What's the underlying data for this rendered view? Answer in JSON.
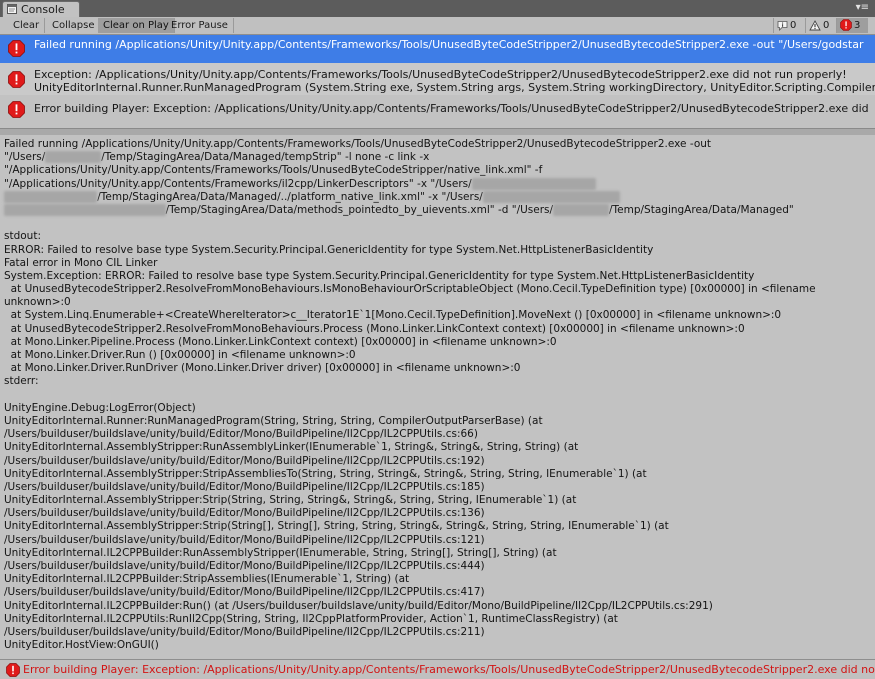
{
  "window": {
    "tab_label": "Console"
  },
  "toolbar": {
    "clear_label": "Clear",
    "collapse_label": "Collapse",
    "clear_on_play_label": "Clear on Play",
    "error_pause_label": "Error Pause",
    "info_count": "0",
    "warning_count": "0",
    "error_count": "3"
  },
  "log_entries": [
    {
      "line1": "Failed running /Applications/Unity/Unity.app/Contents/Frameworks/Tools/UnusedByteCodeStripper2/UnusedBytecodeStripper2.exe -out \"/Users/godstar",
      "line2": ""
    },
    {
      "line1": "Exception: /Applications/Unity/Unity.app/Contents/Frameworks/Tools/UnusedByteCodeStripper2/UnusedBytecodeStripper2.exe did not run properly!",
      "line2": "UnityEditorInternal.Runner.RunManagedProgram (System.String exe, System.String args, System.String workingDirectory, UnityEditor.Scripting.Compilers.Co"
    },
    {
      "line1": "Error building Player: Exception: /Applications/Unity/Unity.app/Contents/Frameworks/Tools/UnusedByteCodeStripper2/UnusedBytecodeStripper2.exe did",
      "line2": ""
    }
  ],
  "detail": {
    "lines": [
      "Failed running /Applications/Unity/Unity.app/Contents/Frameworks/Tools/UnusedByteCodeStripper2/UnusedBytecodeStripper2.exe -out",
      "\"/Users/{B}/Temp/StagingArea/Data/Managed/tempStrip\" -l none -c link -x",
      "\"/Applications/Unity/Unity.app/Contents/Frameworks/Tools/UnusedByteCodeStripper/native_link.xml\" -f",
      "\"/Applications/Unity/Unity.app/Contents/Frameworks/il2cpp/LinkerDescriptors\" -x \"/Users/{B}",
      "{B}/Temp/StagingArea/Data/Managed/../platform_native_link.xml\" -x \"/Users/{B}",
      "{B}/Temp/StagingArea/Data/methods_pointedto_by_uievents.xml\" -d \"/Users/{B}/Temp/StagingArea/Data/Managed\"",
      "",
      "stdout:",
      "ERROR: Failed to resolve base type System.Security.Principal.GenericIdentity for type System.Net.HttpListenerBasicIdentity",
      "Fatal error in Mono CIL Linker",
      "System.Exception: ERROR: Failed to resolve base type System.Security.Principal.GenericIdentity for type System.Net.HttpListenerBasicIdentity",
      "  at UnusedBytecodeStripper2.ResolveFromMonoBehaviours.IsMonoBehaviourOrScriptableObject (Mono.Cecil.TypeDefinition type) [0x00000] in <filename",
      "unknown>:0",
      "  at System.Linq.Enumerable+<CreateWhereIterator>c__Iterator1E`1[Mono.Cecil.TypeDefinition].MoveNext () [0x00000] in <filename unknown>:0",
      "  at UnusedBytecodeStripper2.ResolveFromMonoBehaviours.Process (Mono.Linker.LinkContext context) [0x00000] in <filename unknown>:0",
      "  at Mono.Linker.Pipeline.Process (Mono.Linker.LinkContext context) [0x00000] in <filename unknown>:0",
      "  at Mono.Linker.Driver.Run () [0x00000] in <filename unknown>:0",
      "  at Mono.Linker.Driver.RunDriver (Mono.Linker.Driver driver) [0x00000] in <filename unknown>:0",
      "stderr:",
      "",
      "UnityEngine.Debug:LogError(Object)",
      "UnityEditorInternal.Runner:RunManagedProgram(String, String, String, CompilerOutputParserBase) (at",
      "/Users/builduser/buildslave/unity/build/Editor/Mono/BuildPipeline/Il2Cpp/IL2CPPUtils.cs:66)",
      "UnityEditorInternal.AssemblyStripper:RunAssemblyLinker(IEnumerable`1, String&, String&, String, String) (at",
      "/Users/builduser/buildslave/unity/build/Editor/Mono/BuildPipeline/Il2Cpp/IL2CPPUtils.cs:192)",
      "UnityEditorInternal.AssemblyStripper:StripAssembliesTo(String, String, String&, String&, String, String, IEnumerable`1) (at",
      "/Users/builduser/buildslave/unity/build/Editor/Mono/BuildPipeline/Il2Cpp/IL2CPPUtils.cs:185)",
      "UnityEditorInternal.AssemblyStripper:Strip(String, String, String&, String&, String, String, IEnumerable`1) (at",
      "/Users/builduser/buildslave/unity/build/Editor/Mono/BuildPipeline/Il2Cpp/IL2CPPUtils.cs:136)",
      "UnityEditorInternal.AssemblyStripper:Strip(String[], String[], String, String, String&, String&, String, String, IEnumerable`1) (at",
      "/Users/builduser/buildslave/unity/build/Editor/Mono/BuildPipeline/Il2Cpp/IL2CPPUtils.cs:121)",
      "UnityEditorInternal.IL2CPPBuilder:RunAssemblyStripper(IEnumerable, String, String[], String[], String) (at",
      "/Users/builduser/buildslave/unity/build/Editor/Mono/BuildPipeline/Il2Cpp/IL2CPPUtils.cs:444)",
      "UnityEditorInternal.IL2CPPBuilder:StripAssemblies(IEnumerable`1, String) (at",
      "/Users/builduser/buildslave/unity/build/Editor/Mono/BuildPipeline/Il2Cpp/IL2CPPUtils.cs:417)",
      "UnityEditorInternal.IL2CPPBuilder:Run() (at /Users/builduser/buildslave/unity/build/Editor/Mono/BuildPipeline/Il2Cpp/IL2CPPUtils.cs:291)",
      "UnityEditorInternal.IL2CPPUtils:RunIl2Cpp(String, String, Il2CppPlatformProvider, Action`1, RuntimeClassRegistry) (at",
      "/Users/builduser/buildslave/unity/build/Editor/Mono/BuildPipeline/Il2Cpp/IL2CPPUtils.cs:211)",
      "UnityEditor.HostView:OnGUI()"
    ]
  },
  "status_bar": {
    "message": "Error building Player: Exception: /Applications/Unity/Unity.app/Contents/Frameworks/Tools/UnusedByteCodeStripper2/UnusedBytecodeStripper2.exe did not r"
  },
  "colors": {
    "selection": "#3e7de7",
    "error_red": "#d21414",
    "panel_bg": "#c2c2c2"
  },
  "icons": {
    "tab": "console-icon",
    "info": "info-icon",
    "warning": "warning-icon",
    "error": "error-icon",
    "menu": "window-menu-icon"
  }
}
